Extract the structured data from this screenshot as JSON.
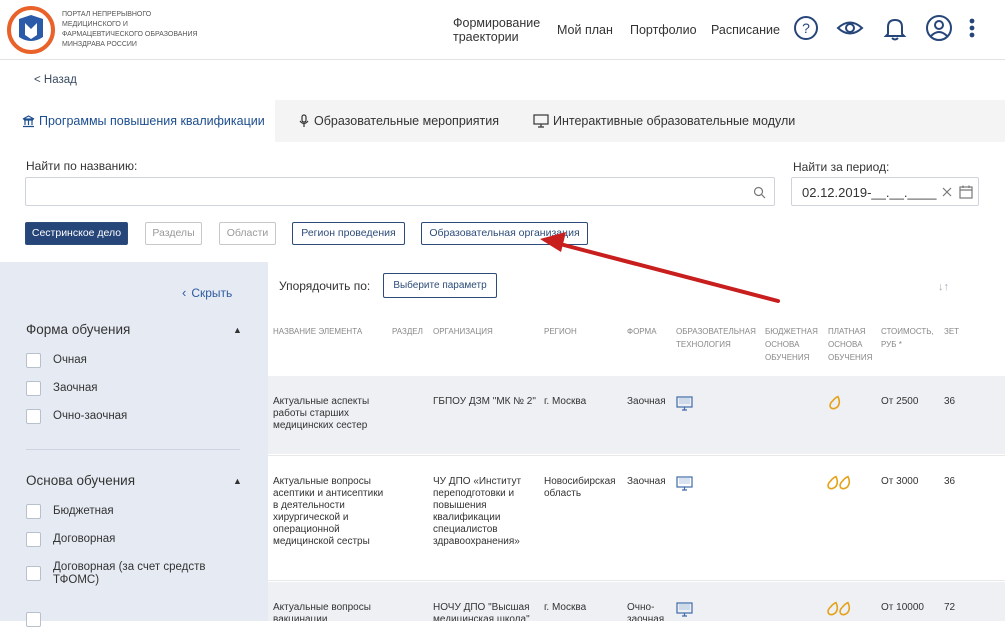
{
  "header": {
    "logo_text": "Портал непрерывного медицинского и фармацевтического образования Минздрава России",
    "nav": [
      "Формирование траектории",
      "Мой план",
      "Портфолио",
      "Расписание"
    ],
    "icons": [
      "help-icon",
      "eye-icon",
      "bell-icon",
      "user-icon",
      "more-icon"
    ]
  },
  "back_label": "< Назад",
  "tabs": [
    {
      "label": "Программы повышения квалификации",
      "icon": "institution-icon",
      "active": true
    },
    {
      "label": "Образовательные мероприятия",
      "icon": "microphone-icon",
      "active": false
    },
    {
      "label": "Интерактивные образовательные модули",
      "icon": "monitor-icon",
      "active": false
    }
  ],
  "search": {
    "label": "Найти по названию:",
    "value": ""
  },
  "period": {
    "label": "Найти за период:",
    "value": "02.12.2019-__.__.____"
  },
  "filters": [
    "Сестринское дело",
    "Разделы",
    "Области",
    "Регион проведения",
    "Образовательная организация"
  ],
  "sidebar": {
    "hide_label": "Скрыть",
    "sections": [
      {
        "title": "Форма обучения",
        "options": [
          "Очная",
          "Заочная",
          "Очно-заочная"
        ]
      },
      {
        "title": "Основа обучения",
        "options": [
          "Бюджетная",
          "Договорная",
          "Договорная (за счет средств ТФОМС)"
        ]
      }
    ]
  },
  "sort": {
    "label": "Упорядочить по:",
    "button": "Выберите параметр"
  },
  "table": {
    "headers": [
      "Название элемента",
      "Раздел",
      "Организация",
      "Регион",
      "Форма",
      "Образовательная технология",
      "Бюджетная основа обучения",
      "Платная основа обучения",
      "Стоимость, руб *",
      "ЗЕТ"
    ],
    "rows": [
      {
        "name": "Актуальные аспекты работы старших медицинских сестер",
        "section": "",
        "org": "ГБПОУ ДЗМ \"МК № 2\"",
        "region": "г. Москва",
        "form": "Заочная",
        "cost": "От 2500",
        "zet": "36",
        "pay": "single"
      },
      {
        "name": "Актуальные вопросы асептики и антисептики в деятельности хирургической и операционной медицинской сестры",
        "section": "",
        "org": "ЧУ ДПО «Институт переподготовки и повышения квалификации специалистов здравоохранения»",
        "region": "Новосибирская область",
        "form": "Заочная",
        "cost": "От 3000",
        "zet": "36",
        "pay": "double"
      },
      {
        "name": "Актуальные вопросы вакцинации",
        "section": "",
        "org": "НОЧУ ДПО \"Высшая медицинская школа\"",
        "region": "г. Москва",
        "form": "Очно-заочная",
        "cost": "От 10000",
        "zet": "72",
        "pay": "double"
      }
    ]
  },
  "colors": {
    "primary": "#26467a",
    "accent_logo": "#e8622a",
    "link": "#2d5aa0",
    "sidebar_bg": "#e6ebf3",
    "annotation_arrow": "#c81e1e"
  }
}
